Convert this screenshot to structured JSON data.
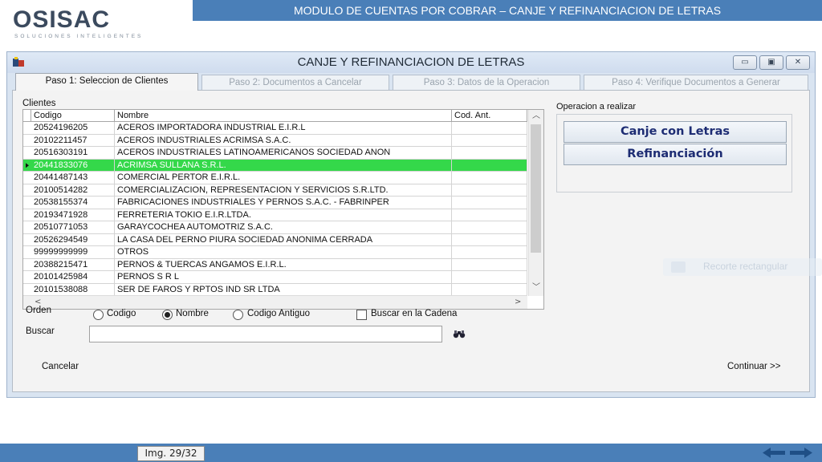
{
  "slide": {
    "title": "MODULO DE CUENTAS POR COBRAR – CANJE Y REFINANCIACION DE LETRAS",
    "image_counter": "Img. 29/32",
    "logo_text": "OSISAC",
    "logo_tagline": "SOLUCIONES INTELIGENTES"
  },
  "window": {
    "title": "CANJE Y REFINANCIACION DE LETRAS",
    "tabs": [
      {
        "label": "Paso 1: Seleccion de Clientes",
        "active": true
      },
      {
        "label": "Paso 2: Documentos a Cancelar",
        "active": false
      },
      {
        "label": "Paso 3: Datos de la Operacion",
        "active": false
      },
      {
        "label": "Paso 4: Verifique Documentos a Generar",
        "active": false
      }
    ]
  },
  "clients": {
    "section_label": "Clientes",
    "columns": [
      "Codigo",
      "Nombre",
      "Cod. Ant."
    ],
    "rows": [
      {
        "code": "20524196205",
        "name": "ACEROS IMPORTADORA INDUSTRIAL E.I.R.L",
        "old": ""
      },
      {
        "code": "20102211457",
        "name": "ACEROS INDUSTRIALES ACRIMSA S.A.C.",
        "old": ""
      },
      {
        "code": "20516303191",
        "name": "ACEROS INDUSTRIALES LATINOAMERICANOS SOCIEDAD ANON",
        "old": ""
      },
      {
        "code": "20441833076",
        "name": "ACRIMSA SULLANA S.R.L.",
        "old": ""
      },
      {
        "code": "20441487143",
        "name": "COMERCIAL PERTOR E.I.R.L.",
        "old": ""
      },
      {
        "code": "20100514282",
        "name": "COMERCIALIZACION, REPRESENTACION Y SERVICIOS S.R.LTD.",
        "old": ""
      },
      {
        "code": "20538155374",
        "name": "FABRICACIONES INDUSTRIALES Y PERNOS S.A.C. - FABRINPER",
        "old": ""
      },
      {
        "code": "20193471928",
        "name": "FERRETERIA TOKIO E.I.R.LTDA.",
        "old": ""
      },
      {
        "code": "20510771053",
        "name": "GARAYCOCHEA AUTOMOTRIZ S.A.C.",
        "old": ""
      },
      {
        "code": "20526294549",
        "name": "LA CASA DEL PERNO PIURA SOCIEDAD ANONIMA CERRADA",
        "old": ""
      },
      {
        "code": "99999999999",
        "name": "OTROS",
        "old": ""
      },
      {
        "code": "20388215471",
        "name": "PERNOS & TUERCAS ANGAMOS E.I.R.L.",
        "old": ""
      },
      {
        "code": "20101425984",
        "name": "PERNOS S R L",
        "old": ""
      },
      {
        "code": "20101538088",
        "name": "SER DE FAROS Y RPTOS IND SR LTDA",
        "old": ""
      }
    ],
    "selected_index": 3
  },
  "operation": {
    "label": "Operacion a realizar",
    "buttons": [
      "Canje con Letras",
      "Refinanciación"
    ]
  },
  "order": {
    "label": "Orden",
    "options": [
      "Codigo",
      "Nombre",
      "Codigo Antiguo"
    ],
    "selected": "Nombre",
    "chain_label": "Buscar en la Cadena",
    "chain_checked": false
  },
  "search": {
    "label": "Buscar",
    "value": ""
  },
  "actions": {
    "cancel": "Cancelar",
    "continue": "Continuar >>"
  },
  "ghost_tooltip": "Recorte rectangular",
  "colors": {
    "header_blue": "#4a7fb8",
    "selected_row": "#34d84a",
    "button_text": "#1d2c73"
  }
}
